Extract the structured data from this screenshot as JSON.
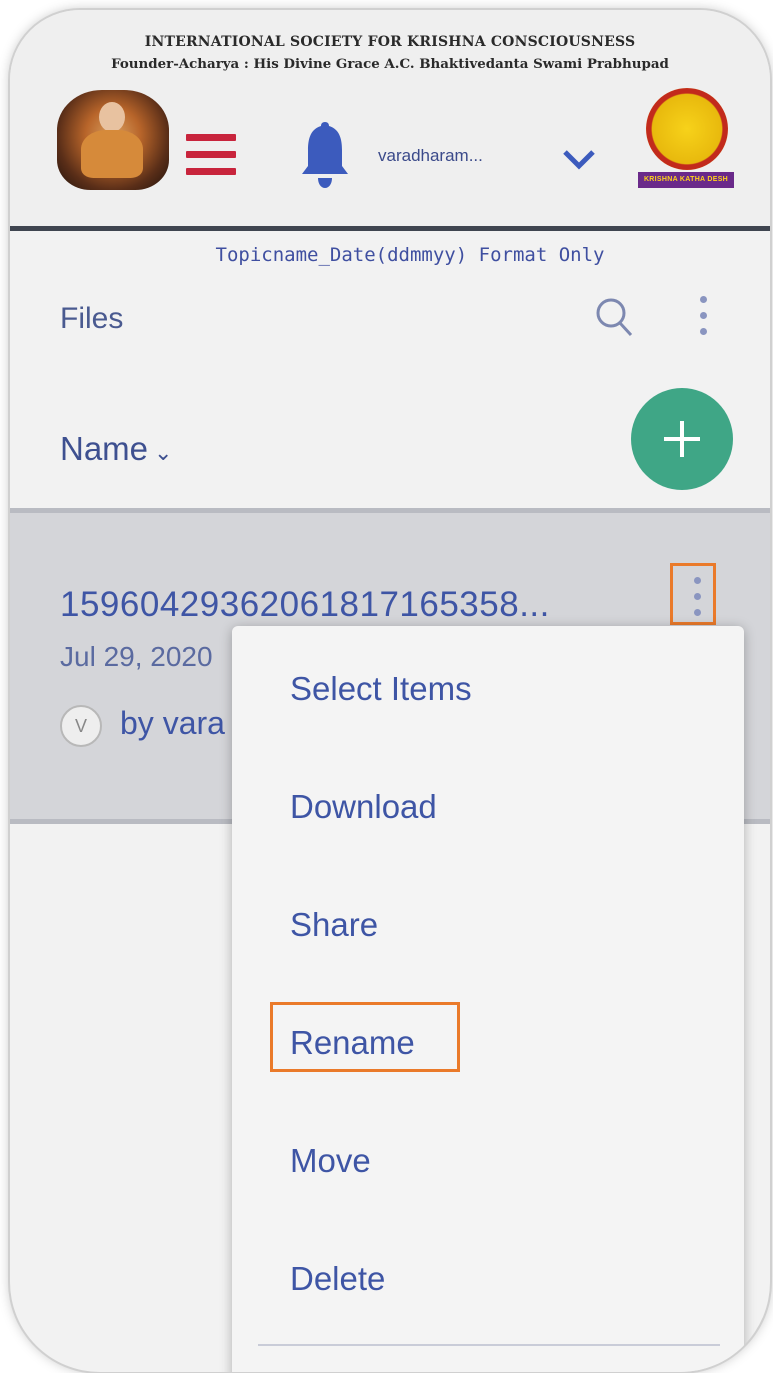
{
  "header": {
    "org_title": "INTERNATIONAL SOCIETY FOR KRISHNA CONSCIOUSNESS",
    "org_subtitle": "Founder-Acharya : His Divine Grace A.C. Bhaktivedanta Swami Prabhupad",
    "user_name": "varadharam...",
    "logo_text": "KRISHNA KATHA DESH",
    "hamburger_color": "#c8243c",
    "bell_color": "#3c5bbd"
  },
  "hint": "Topicname_Date(ddmmyy) Format Only",
  "files": {
    "title": "Files",
    "sort_label": "Name",
    "accent_color": "#3fa686"
  },
  "file_row": {
    "name": "15960429362061817165358...",
    "date": "Jul 29, 2020",
    "owner_initial": "V",
    "owner_text": "by vara"
  },
  "context_menu": {
    "items": [
      "Select Items",
      "Download",
      "Share",
      "Rename",
      "Move",
      "Delete"
    ],
    "highlight_color": "#ea7a2a"
  }
}
